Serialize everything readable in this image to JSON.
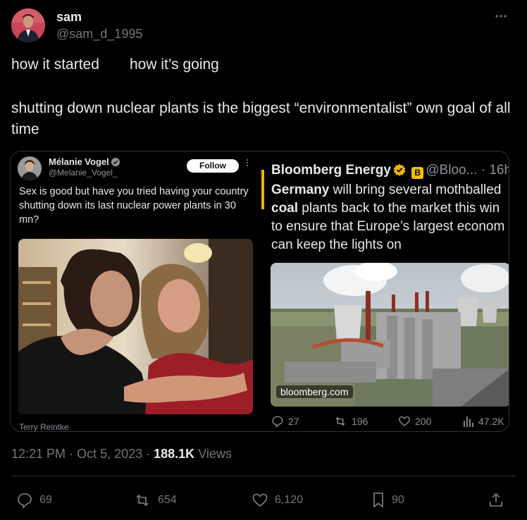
{
  "author": {
    "name": "sam",
    "handle": "@sam_d_1995"
  },
  "tweet": {
    "line1_left": "how it started",
    "line1_right": "how it’s going",
    "text": "shutting down nuclear plants is the biggest “environmentalist” own goal of all time"
  },
  "quoted_left": {
    "name": "Mélanie Vogel",
    "handle": "@Melanie_Vogel_",
    "follow_label": "Follow",
    "text": "Sex is good but have you tried having your country shutting down its last nuclear power plants in 30 mn?",
    "photo_credit": "Terry Reintke"
  },
  "quoted_right": {
    "name": "Bloomberg Energy",
    "badge_letter": "B",
    "handle": "@Bloo...",
    "separator": "·",
    "time": "16h",
    "text_line1_bold": "Germany",
    "text_line1_rest": " will bring several mothballed",
    "text_line2_bold": "coal",
    "text_line2_rest": " plants back to the market this win",
    "text_line3": "to ensure that Europe’s largest econom",
    "text_line4": "can keep the lights on",
    "link_domain": "bloomberg.com",
    "replies": "27",
    "reposts": "196",
    "likes": "200",
    "views": "47.2K"
  },
  "meta": {
    "time": "12:21 PM",
    "date": "Oct 5, 2023",
    "views_count": "188.1K",
    "views_label": "Views"
  },
  "actions": {
    "replies": "69",
    "reposts": "654",
    "likes": "6,120",
    "bookmarks": "90"
  },
  "colors": {
    "background": "#000000",
    "text": "#e7e9ea",
    "muted": "#71767b",
    "gold_verified": "#f2b300"
  }
}
